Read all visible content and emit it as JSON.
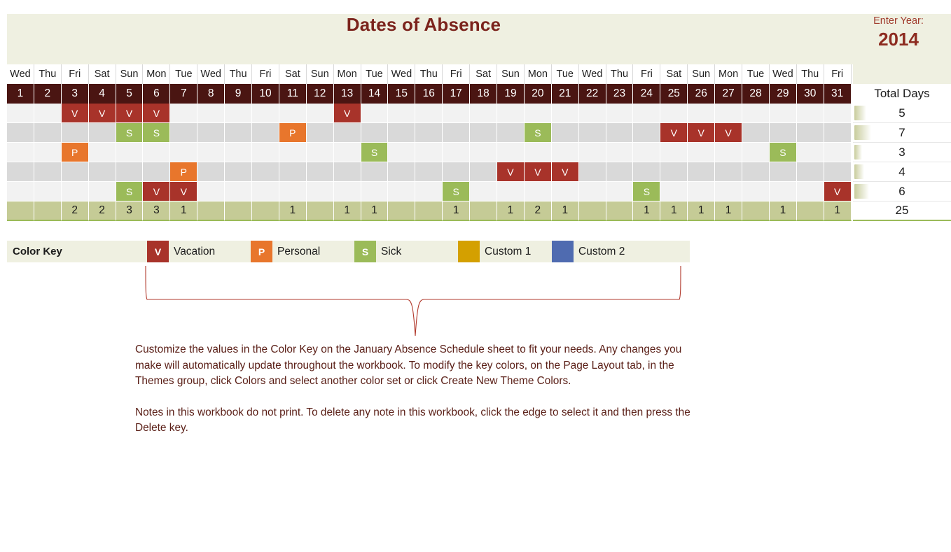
{
  "header": {
    "title": "Dates of Absence",
    "year_label": "Enter Year:",
    "year_value": "2014"
  },
  "colors": {
    "banner_bg": "#eff0e1",
    "title": "#7b231c",
    "date_row": "#4a1512",
    "vacation": "#a8332a",
    "personal": "#e8762c",
    "sick": "#9bbb59",
    "custom1": "#d4a000",
    "custom2": "#4f6bb0",
    "totals_row": "#c5cb96"
  },
  "calendar": {
    "total_days_header": "Total Days",
    "weekdays": [
      "Wed",
      "Thu",
      "Fri",
      "Sat",
      "Sun",
      "Mon",
      "Tue",
      "Wed",
      "Thu",
      "Fri",
      "Sat",
      "Sun",
      "Mon",
      "Tue",
      "Wed",
      "Thu",
      "Fri",
      "Sat",
      "Sun",
      "Mon",
      "Tue",
      "Wed",
      "Thu",
      "Fri",
      "Sat",
      "Sun",
      "Mon",
      "Tue",
      "Wed",
      "Thu",
      "Fri"
    ],
    "dates": [
      "1",
      "2",
      "3",
      "4",
      "5",
      "6",
      "7",
      "8",
      "9",
      "10",
      "11",
      "12",
      "13",
      "14",
      "15",
      "16",
      "17",
      "18",
      "19",
      "20",
      "21",
      "22",
      "23",
      "24",
      "25",
      "26",
      "27",
      "28",
      "29",
      "30",
      "31"
    ],
    "rows": [
      {
        "shade": "odd",
        "cells": [
          "",
          "",
          "V",
          "V",
          "V",
          "V",
          "",
          "",
          "",
          "",
          "",
          "",
          "V",
          "",
          "",
          "",
          "",
          "",
          "",
          "",
          "",
          "",
          "",
          "",
          "",
          "",
          "",
          "",
          "",
          "",
          ""
        ],
        "total": "5",
        "bar_pct": 58
      },
      {
        "shade": "even",
        "cells": [
          "",
          "",
          "",
          "",
          "S",
          "S",
          "",
          "",
          "",
          "",
          "P",
          "",
          "",
          "",
          "",
          "",
          "",
          "",
          "",
          "S",
          "",
          "",
          "",
          "",
          "V",
          "V",
          "V",
          "",
          "",
          "",
          ""
        ],
        "total": "7",
        "bar_pct": 80
      },
      {
        "shade": "odd",
        "cells": [
          "",
          "",
          "P",
          "",
          "",
          "",
          "",
          "",
          "",
          "",
          "",
          "",
          "",
          "S",
          "",
          "",
          "",
          "",
          "",
          "",
          "",
          "",
          "",
          "",
          "",
          "",
          "",
          "",
          "S",
          "",
          ""
        ],
        "total": "3",
        "bar_pct": 35
      },
      {
        "shade": "even",
        "cells": [
          "",
          "",
          "",
          "",
          "",
          "",
          "P",
          "",
          "",
          "",
          "",
          "",
          "",
          "",
          "",
          "",
          "",
          "",
          "V",
          "V",
          "V",
          "",
          "",
          "",
          "",
          "",
          "",
          "",
          "",
          "",
          ""
        ],
        "total": "4",
        "bar_pct": 46
      },
      {
        "shade": "odd",
        "cells": [
          "",
          "",
          "",
          "",
          "S",
          "V",
          "V",
          "",
          "",
          "",
          "",
          "",
          "",
          "",
          "",
          "",
          "S",
          "",
          "",
          "",
          "",
          "",
          "",
          "S",
          "",
          "",
          "",
          "",
          "",
          "",
          "V"
        ],
        "total": "6",
        "bar_pct": 69
      }
    ],
    "totals": [
      "",
      "",
      "2",
      "2",
      "3",
      "3",
      "1",
      "",
      "",
      "",
      "1",
      "",
      "1",
      "1",
      "",
      "",
      "1",
      "",
      "1",
      "2",
      "1",
      "",
      "",
      "1",
      "1",
      "1",
      "1",
      "",
      "1",
      "",
      "1"
    ],
    "grand_total": "25"
  },
  "color_key": {
    "title": "Color Key",
    "items": [
      {
        "symbol": "V",
        "label": "Vacation",
        "swatch": "v"
      },
      {
        "symbol": "P",
        "label": "Personal",
        "swatch": "p"
      },
      {
        "symbol": "S",
        "label": "Sick",
        "swatch": "s"
      },
      {
        "symbol": "",
        "label": "Custom 1",
        "swatch": "c1"
      },
      {
        "symbol": "",
        "label": "Custom 2",
        "swatch": "c2"
      }
    ]
  },
  "note": {
    "paragraph1": "Customize the values in the Color Key on the January Absence Schedule sheet to fit your needs. Any changes you make will automatically update throughout the workbook.  To modify the key colors, on the Page Layout tab, in the Themes group, click Colors and select another color set or click Create New Theme Colors.",
    "paragraph2": "Notes in this workbook do not print. To delete any note in this workbook, click the edge to select it and then press the Delete key."
  }
}
